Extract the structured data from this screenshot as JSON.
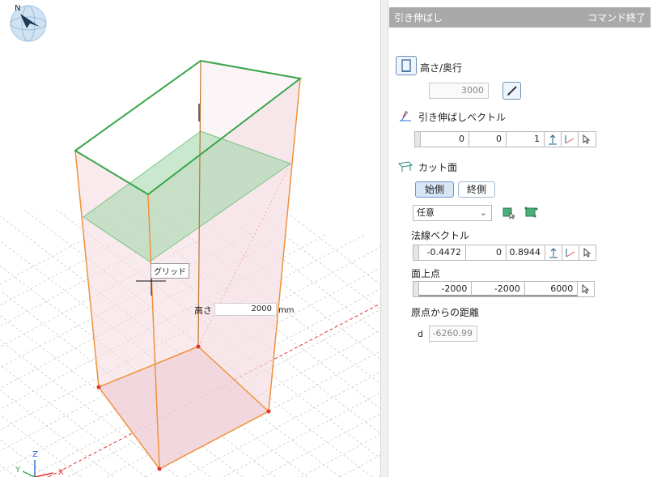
{
  "viewport": {
    "compass_label": "N",
    "grid_tooltip": "グリッド",
    "height_label": "高さ",
    "height_value": "2000",
    "height_unit": "mm",
    "axis_labels": {
      "x": "X",
      "y": "Y",
      "z": "Z"
    }
  },
  "panel": {
    "title": "引き伸ばし",
    "end_command": "コマンド終了",
    "height_depth": {
      "label": "高さ/奥行",
      "value": "3000"
    },
    "extrude_vector": {
      "label": "引き伸ばしベクトル",
      "values": [
        "0",
        "0",
        "1"
      ]
    },
    "cut_plane": {
      "label": "カット面",
      "start_side": "始側",
      "end_side": "終側",
      "mode": "任意"
    },
    "normal_vector": {
      "label": "法線ベクトル",
      "values": [
        "-0.4472",
        "0",
        "0.8944"
      ]
    },
    "plane_point": {
      "label": "面上点",
      "values": [
        "-2000",
        "-2000",
        "6000"
      ]
    },
    "distance": {
      "label": "原点からの距離",
      "symbol": "d",
      "value": "-6260.99"
    }
  },
  "colors": {
    "edge_orange": "#f0923c",
    "top_green": "#3aa64a",
    "box_fill": "#f3d9df",
    "plane_fill": "#9fd6a5",
    "grid": "#c9c9c9",
    "axis_x_red": "#e53030",
    "header_gray": "#a9a9a9"
  },
  "icons": [
    "compass-icon",
    "height-icon",
    "pencil-icon",
    "vector-icon",
    "cut-plane-icon",
    "direction-up-icon",
    "direction-3d-icon",
    "pick-cursor-icon",
    "select-face-icon",
    "select-points-icon"
  ]
}
